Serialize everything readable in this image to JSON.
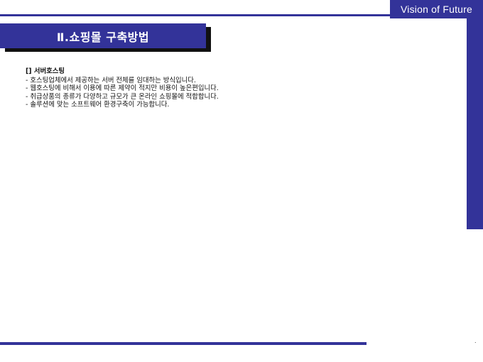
{
  "header": {
    "brand": "Vision of Future",
    "accent_color": "#333399"
  },
  "title": "Ⅱ.쇼핑몰 구축방법",
  "section": {
    "heading": "[] 서버호스팅",
    "bullets": [
      "- 호스팅업체에서 제공하는 서버 전체를 임대하는 방식입니다.",
      "- 웹호스팅에 비해서 이용에 따른 제약이 적지만 비용이 높은편입니다.",
      "- 취급상품의 종류가 다양하고 규모가 큰 온라인 쇼핑몰에 적합합니다.",
      "- 솔루션에 맞는 소프트웨어 환경구축이 가능합니다."
    ]
  },
  "footer": {
    "mark": "."
  }
}
